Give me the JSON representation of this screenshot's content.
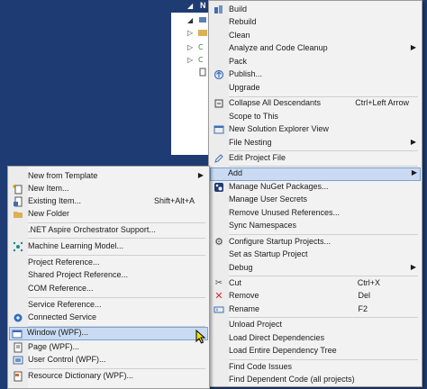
{
  "tree": {
    "label": "N"
  },
  "main_menu": {
    "items": [
      {
        "label": "Build",
        "icon": "build-icon"
      },
      {
        "label": "Rebuild",
        "icon": ""
      },
      {
        "label": "Clean",
        "icon": ""
      },
      {
        "label": "Analyze and Code Cleanup",
        "icon": "",
        "submenu": true
      },
      {
        "label": "Pack",
        "icon": ""
      },
      {
        "label": "Publish...",
        "icon": "publish-icon"
      },
      {
        "label": "Upgrade",
        "icon": ""
      },
      {
        "label": "Collapse All Descendants",
        "icon": "collapse-icon",
        "shortcut": "Ctrl+Left Arrow"
      },
      {
        "label": "Scope to This",
        "icon": ""
      },
      {
        "label": "New Solution Explorer View",
        "icon": "new-view-icon"
      },
      {
        "label": "File Nesting",
        "icon": "",
        "submenu": true
      },
      {
        "label": "Edit Project File",
        "icon": "edit-file-icon"
      },
      {
        "label": "Add",
        "icon": "",
        "submenu": true
      },
      {
        "label": "Manage NuGet Packages...",
        "icon": "nuget-icon"
      },
      {
        "label": "Manage User Secrets",
        "icon": ""
      },
      {
        "label": "Remove Unused References...",
        "icon": ""
      },
      {
        "label": "Sync Namespaces",
        "icon": ""
      },
      {
        "label": "Configure Startup Projects...",
        "icon": "gear-icon"
      },
      {
        "label": "Set as Startup Project",
        "icon": ""
      },
      {
        "label": "Debug",
        "icon": "",
        "submenu": true
      },
      {
        "label": "Cut",
        "icon": "cut-icon",
        "shortcut": "Ctrl+X"
      },
      {
        "label": "Remove",
        "icon": "remove-icon",
        "shortcut": "Del"
      },
      {
        "label": "Rename",
        "icon": "rename-icon",
        "shortcut": "F2"
      },
      {
        "label": "Unload Project",
        "icon": ""
      },
      {
        "label": "Load Direct Dependencies",
        "icon": ""
      },
      {
        "label": "Load Entire Dependency Tree",
        "icon": ""
      },
      {
        "label": "Find Code Issues",
        "icon": ""
      },
      {
        "label": "Find Dependent Code (all projects)",
        "icon": ""
      }
    ]
  },
  "sub_menu": {
    "items": [
      {
        "label": "New from Template",
        "icon": "",
        "submenu": true
      },
      {
        "label": "New Item...",
        "icon": "new-item-icon"
      },
      {
        "label": "Existing Item...",
        "icon": "existing-item-icon",
        "shortcut": "Shift+Alt+A"
      },
      {
        "label": "New Folder",
        "icon": "folder-icon"
      },
      {
        "label": ".NET Aspire Orchestrator Support...",
        "icon": ""
      },
      {
        "label": "Machine Learning Model...",
        "icon": "ml-model-icon"
      },
      {
        "label": "Project Reference...",
        "icon": ""
      },
      {
        "label": "Shared Project Reference...",
        "icon": ""
      },
      {
        "label": "COM Reference...",
        "icon": ""
      },
      {
        "label": "Service Reference...",
        "icon": ""
      },
      {
        "label": "Connected Service",
        "icon": "connected-service-icon"
      },
      {
        "label": "Window (WPF)...",
        "icon": "wpf-window-icon"
      },
      {
        "label": "Page (WPF)...",
        "icon": "wpf-page-icon"
      },
      {
        "label": "User Control (WPF)...",
        "icon": "user-control-icon"
      },
      {
        "label": "Resource Dictionary (WPF)...",
        "icon": "resource-dictionary-icon"
      }
    ]
  },
  "colors": {
    "background": "#1f3b73",
    "menu_bg": "#f2f2f2",
    "highlight": "#c9daf2",
    "highlight_border": "#7da2ce"
  }
}
